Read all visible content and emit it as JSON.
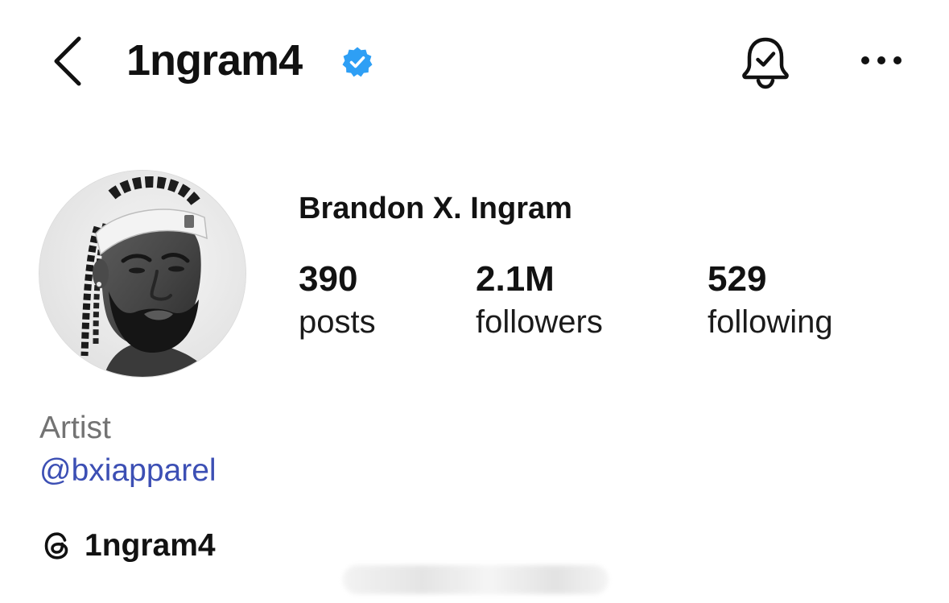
{
  "header": {
    "username": "1ngram4",
    "verified": true,
    "icons": {
      "back": "chevron-left-icon",
      "verified": "verified-badge-icon",
      "notifications": "bell-check-icon",
      "more": "more-horizontal-icon"
    },
    "accent_color": "#2e9ff5"
  },
  "profile": {
    "full_name": "Brandon X. Ingram",
    "avatar": "profile-photo",
    "stats": [
      {
        "value": "390",
        "label": "posts"
      },
      {
        "value": "2.1M",
        "label": "followers"
      },
      {
        "value": "529",
        "label": "following"
      }
    ]
  },
  "bio": {
    "category": "Artist",
    "mention": "@bxiapparel",
    "mention_color": "#3c4fb4",
    "threads_icon": "threads-icon",
    "threads_handle": "1ngram4"
  }
}
